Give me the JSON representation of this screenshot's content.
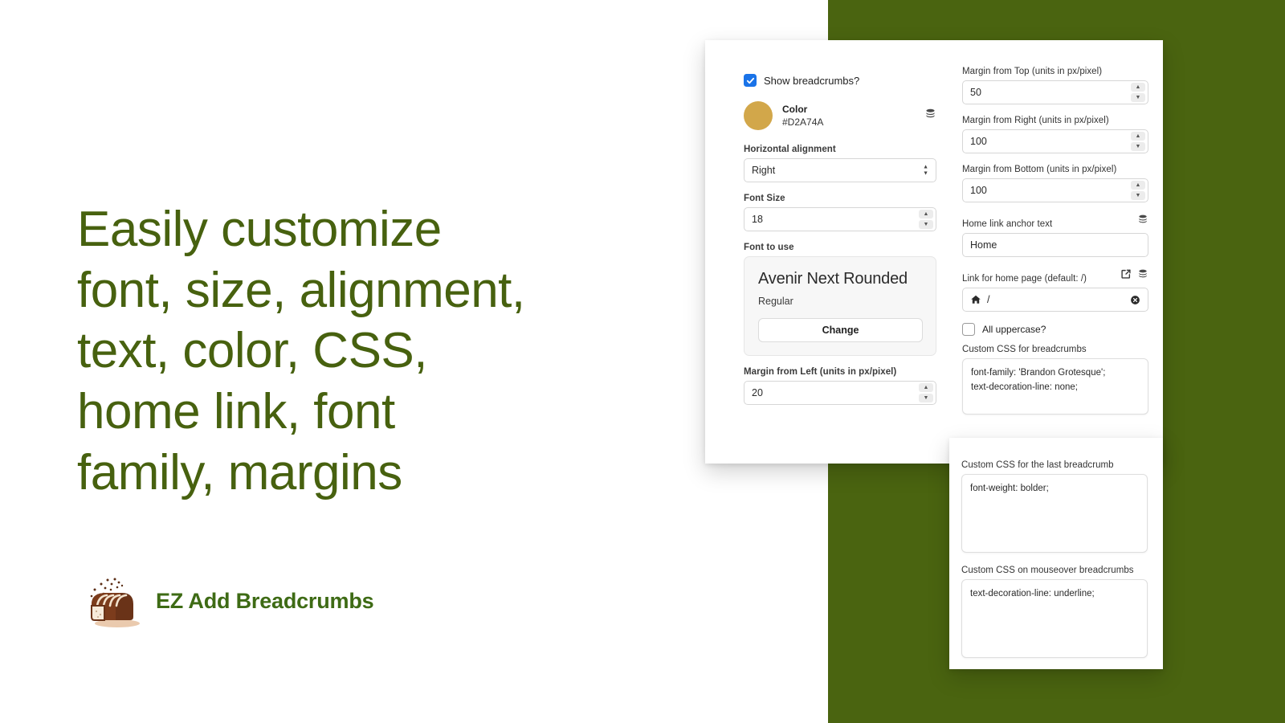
{
  "promo": {
    "headline": "Easily customize\nfont, size, alignment,\ntext, color, CSS,\nhome link, font\nfamily, margins",
    "headline_color": "#47610F",
    "brand_name": "EZ Add Breadcrumbs",
    "brand_icon": "bread-loaf-icon"
  },
  "theme": {
    "green": "#4A6410",
    "accent_blue": "#1A73E8"
  },
  "settings": {
    "show_breadcrumbs": {
      "label": "Show breadcrumbs?",
      "checked": "true",
      "icon": "checkbox-checked-icon"
    },
    "color": {
      "label": "Color",
      "value": "#D2A74A",
      "swatch_icon": "color-swatch-icon",
      "stack_icon": "database-stack-icon"
    },
    "horizontal_alignment": {
      "label": "Horizontal alignment",
      "value": "Right",
      "icon": "select-updown-arrows-icon"
    },
    "font_size": {
      "label": "Font Size",
      "value": "18",
      "icon": "stepper-icon"
    },
    "font_to_use": {
      "label": "Font to use",
      "family": "Avenir Next Rounded",
      "style": "Regular",
      "change_label": "Change"
    },
    "margin_left": {
      "label": "Margin from Left (units in px/pixel)",
      "value": "20"
    },
    "margin_top": {
      "label": "Margin from Top (units in px/pixel)",
      "value": "50"
    },
    "margin_right": {
      "label": "Margin from Right (units in px/pixel)",
      "value": "100"
    },
    "margin_bottom": {
      "label": "Margin from Bottom (units in px/pixel)",
      "value": "100"
    },
    "home_anchor": {
      "label": "Home link anchor text",
      "value": "Home",
      "stack_icon": "database-stack-icon"
    },
    "home_link": {
      "label": "Link for home page (default: /)",
      "value": "/",
      "home_icon": "home-icon",
      "external_icon": "external-link-icon",
      "stack_icon": "database-stack-icon",
      "clear_icon": "clear-circle-icon"
    },
    "all_uppercase": {
      "label": "All uppercase?",
      "checked": "false",
      "icon": "checkbox-unchecked-icon"
    },
    "css_breadcrumbs": {
      "label": "Custom CSS for breadcrumbs",
      "value": "font-family: 'Brandon Grotesque';\ntext-decoration-line: none;"
    },
    "css_last_breadcrumb": {
      "label": "Custom CSS for the last breadcrumb",
      "value": "font-weight: bolder;"
    },
    "css_mouseover": {
      "label": "Custom CSS on mouseover breadcrumbs",
      "value": "text-decoration-line: underline;"
    }
  }
}
